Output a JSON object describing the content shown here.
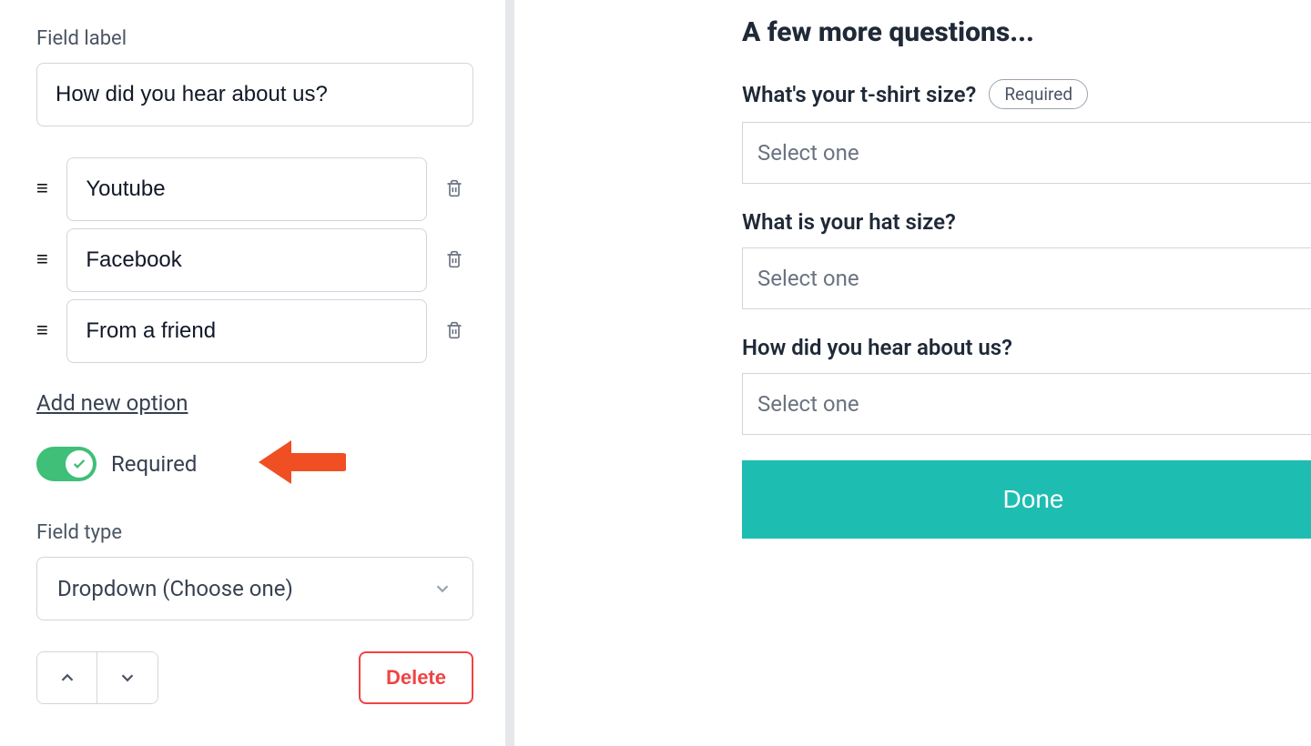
{
  "editor": {
    "field_label_text": "Field label",
    "field_label_value": "How did you hear about us?",
    "options": [
      "Youtube",
      "Facebook",
      "From a friend"
    ],
    "add_option_label": "Add new option",
    "required_label": "Required",
    "required_on": true,
    "field_type_text": "Field type",
    "field_type_value": "Dropdown (Choose one)",
    "delete_label": "Delete"
  },
  "preview": {
    "heading": "A few more questions...",
    "required_badge": "Required",
    "select_placeholder": "Select one",
    "fields": [
      {
        "label": "What's your t-shirt size?",
        "required": true
      },
      {
        "label": "What is your hat size?",
        "required": false
      },
      {
        "label": "How did you hear about us?",
        "required": false
      }
    ],
    "done_label": "Done"
  },
  "colors": {
    "toggle_green": "#3fbf77",
    "done_teal": "#1ebdb2",
    "delete_red": "#ef4444",
    "arrow_orange": "#f04e23"
  }
}
